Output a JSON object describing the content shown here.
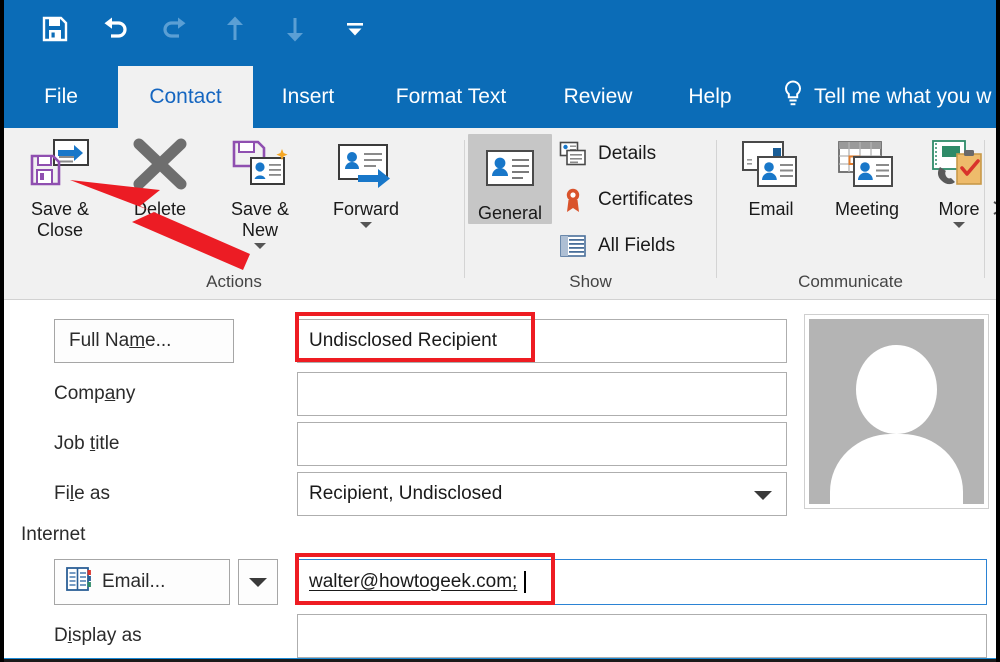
{
  "window": {
    "accent_color": "#0b6cb7",
    "ribbon_bg": "#f1f1f1",
    "highlight_color": "#ee1c22"
  },
  "quick_access": {
    "items": [
      {
        "name": "save-icon",
        "label": "Save",
        "enabled": true
      },
      {
        "name": "undo-icon",
        "label": "Undo",
        "enabled": true
      },
      {
        "name": "redo-icon",
        "label": "Redo",
        "enabled": false
      },
      {
        "name": "previous-item-icon",
        "label": "Previous Item",
        "enabled": false
      },
      {
        "name": "next-item-icon",
        "label": "Next Item",
        "enabled": false
      },
      {
        "name": "customize-quick-access-toolbar-icon",
        "label": "Customize Quick Access Toolbar",
        "enabled": true
      }
    ]
  },
  "tabs": [
    {
      "label": "File",
      "active": false
    },
    {
      "label": "Contact",
      "active": true
    },
    {
      "label": "Insert",
      "active": false
    },
    {
      "label": "Format Text",
      "active": false
    },
    {
      "label": "Review",
      "active": false
    },
    {
      "label": "Help",
      "active": false
    }
  ],
  "tell_me": {
    "label": "Tell me what you w",
    "icon": "lightbulb-icon"
  },
  "ribbon": {
    "groups": [
      {
        "name": "actions",
        "label": "Actions",
        "buttons": [
          {
            "name": "save-and-close",
            "label": "Save &\nClose",
            "caret": false
          },
          {
            "name": "delete",
            "label": "Delete",
            "caret": false
          },
          {
            "name": "save-and-new",
            "label": "Save &\nNew",
            "caret": true
          },
          {
            "name": "forward",
            "label": "Forward",
            "caret": true
          }
        ]
      },
      {
        "name": "show",
        "label": "Show",
        "buttons": [
          {
            "name": "general",
            "label": "General",
            "selected": true
          }
        ],
        "small_buttons": [
          {
            "name": "details",
            "label": "Details",
            "icon": "details-icon"
          },
          {
            "name": "certificates",
            "label": "Certificates",
            "icon": "certificate-icon"
          },
          {
            "name": "all-fields",
            "label": "All Fields",
            "icon": "all-fields-icon"
          }
        ]
      },
      {
        "name": "communicate",
        "label": "Communicate",
        "buttons": [
          {
            "name": "email",
            "label": "Email",
            "caret": false
          },
          {
            "name": "meeting",
            "label": "Meeting",
            "caret": false
          },
          {
            "name": "more",
            "label": "More",
            "caret": true
          }
        ]
      }
    ]
  },
  "form": {
    "full_name_button": {
      "label": "Full Name...",
      "accel": "m"
    },
    "fields": [
      {
        "name": "full-name",
        "label": "",
        "value": "Undisclosed Recipient",
        "highlighted": true
      },
      {
        "name": "company",
        "label": "Company",
        "accel": "a",
        "value": ""
      },
      {
        "name": "job-title",
        "label": "Job title",
        "accel": "t",
        "value": ""
      },
      {
        "name": "file-as",
        "label": "File as",
        "accel": "l",
        "value": "Recipient, Undisclosed",
        "combo": true
      }
    ],
    "internet_section_label": "Internet",
    "email_button": {
      "label": "Email...",
      "icon": "address-book-icon"
    },
    "email_value": "walter@howtogeek.com;",
    "display_as": {
      "label": "Display as",
      "accel": "i",
      "value": ""
    }
  },
  "photo": {
    "name": "contact-photo-placeholder",
    "alt": "contact photo placeholder"
  },
  "annotations": {
    "arrow": {
      "name": "pointer-arrow",
      "color": "#ee1c22",
      "points_to": "save-and-close"
    },
    "boxes": [
      {
        "name": "full-name-highlight",
        "target": "full-name-input"
      },
      {
        "name": "email-highlight",
        "target": "email-input"
      }
    ]
  }
}
